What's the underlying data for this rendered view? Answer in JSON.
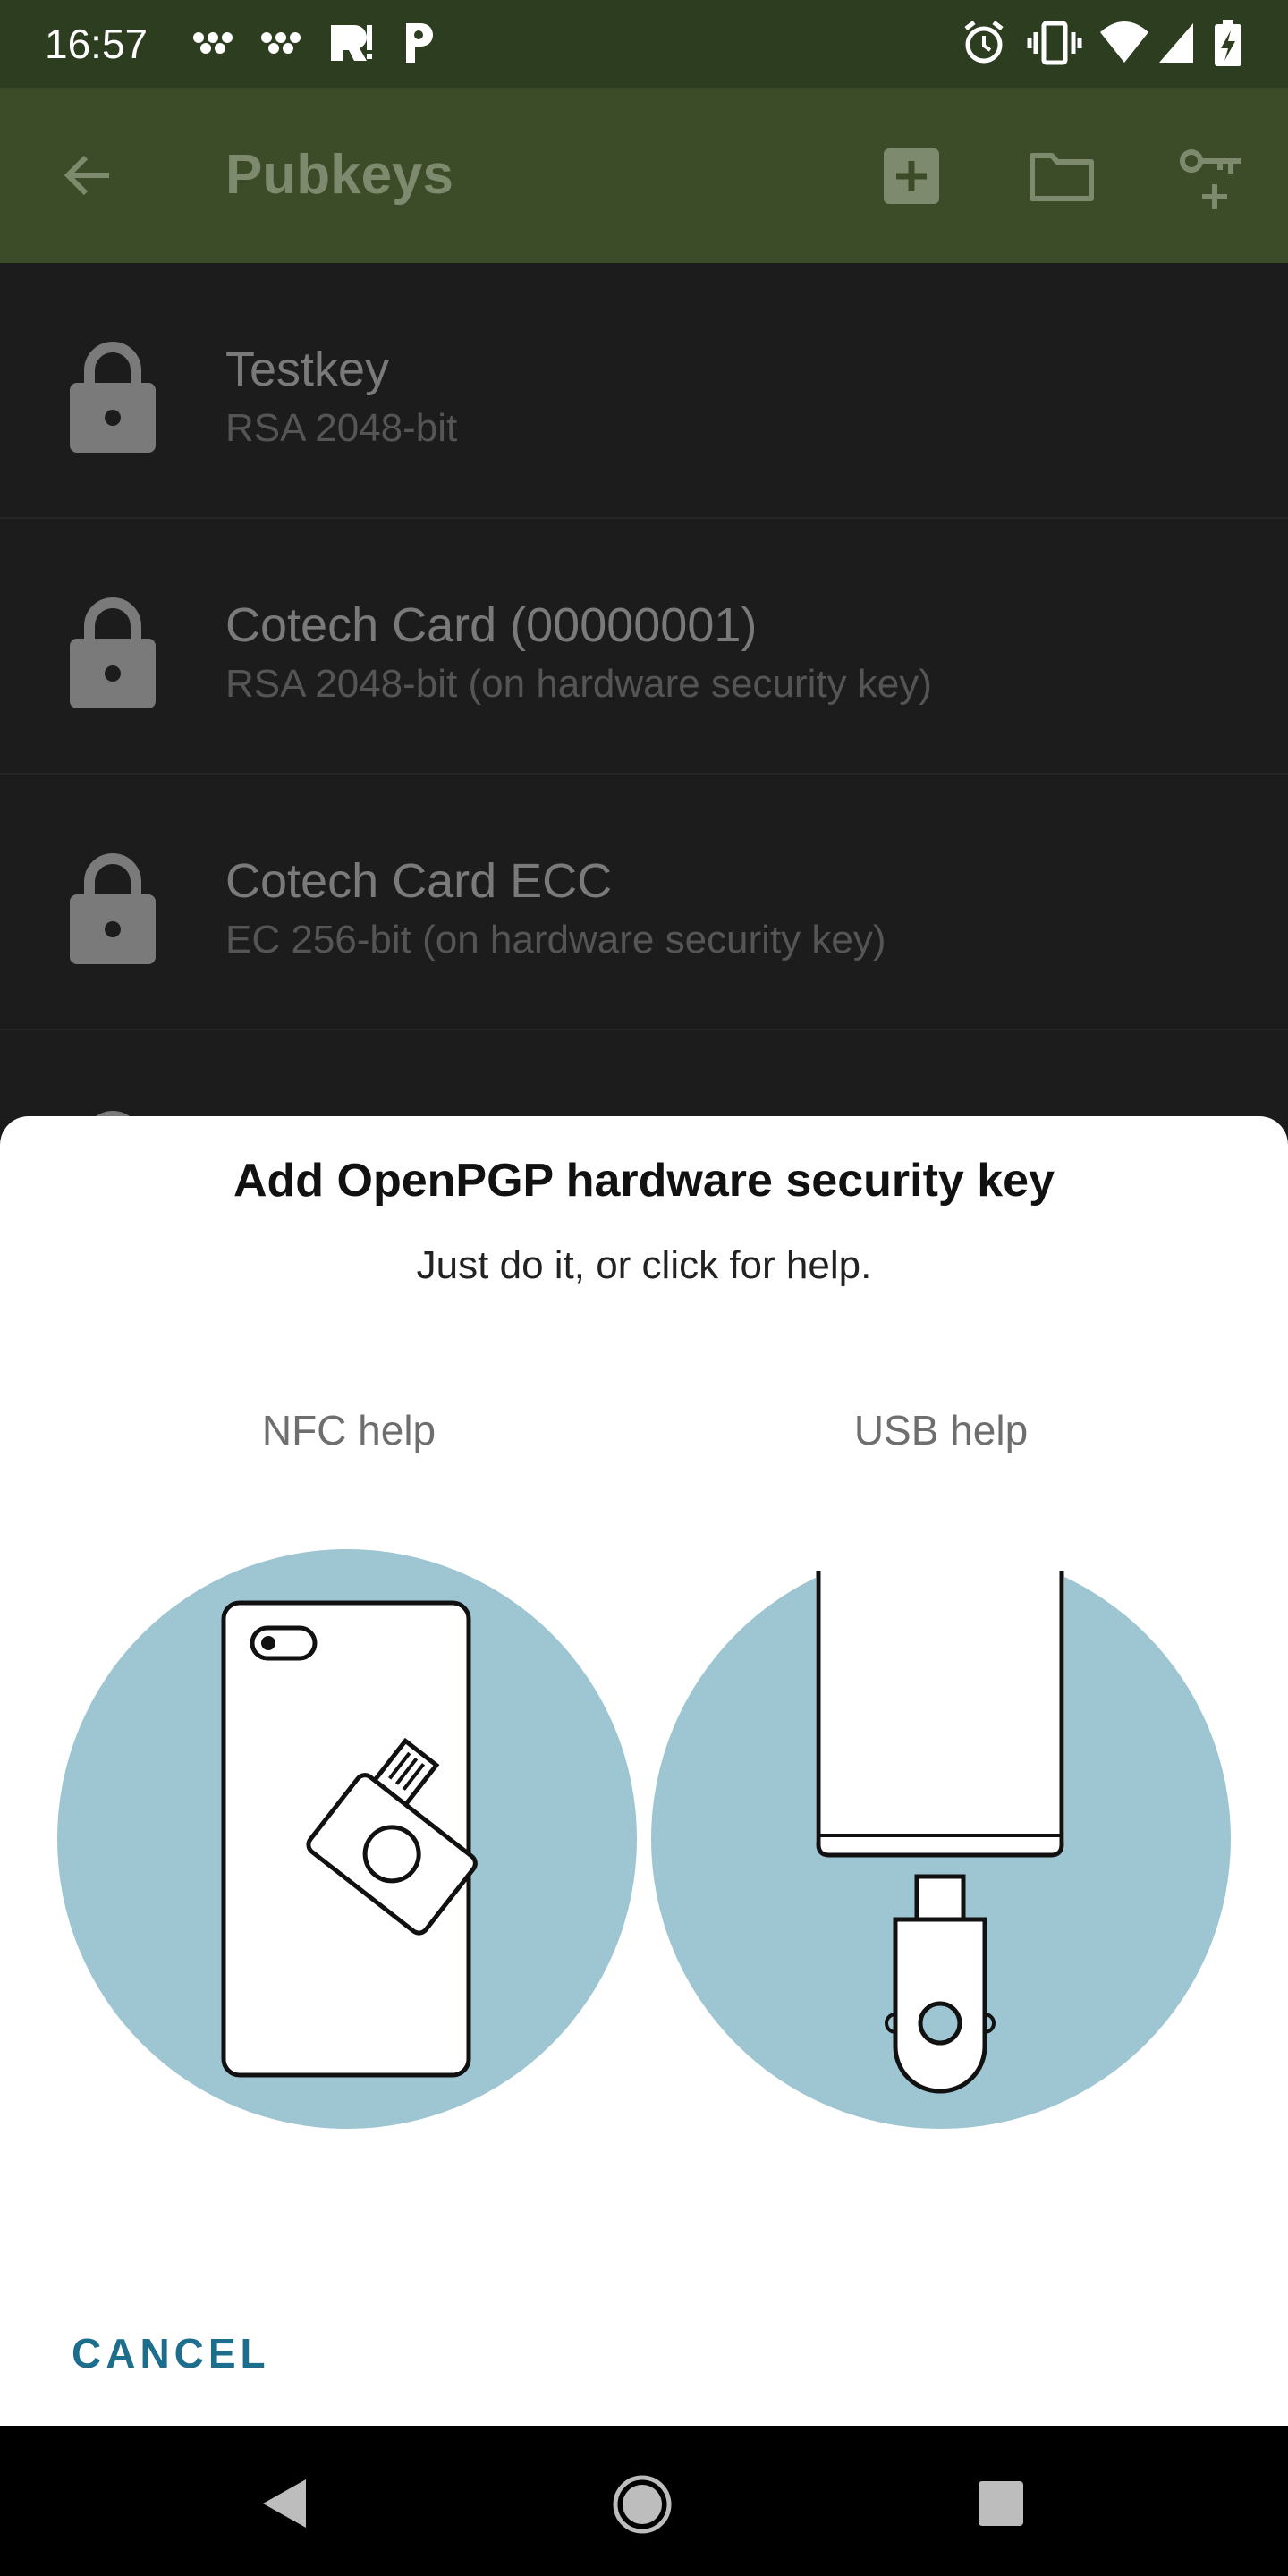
{
  "status_bar": {
    "time": "16:57",
    "left_icons": [
      "notification-dots-icon",
      "notification-dots-icon",
      "app-notification-icon",
      "p-app-icon"
    ],
    "right_icons": [
      "alarm-icon",
      "vibrate-icon",
      "wifi-icon",
      "signal-icon",
      "battery-charging-icon"
    ]
  },
  "app_bar": {
    "title": "Pubkeys",
    "actions": [
      "add-box-icon",
      "folder-icon",
      "key-add-icon"
    ]
  },
  "keys": [
    {
      "name": "Testkey",
      "detail": "RSA 2048-bit"
    },
    {
      "name": "Cotech Card (00000001)",
      "detail": "RSA 2048-bit (on hardware security key)"
    },
    {
      "name": "Cotech Card ECC",
      "detail": "EC 256-bit (on hardware security key)"
    }
  ],
  "dialog": {
    "title": "Add OpenPGP hardware security key",
    "subtitle": "Just do it, or click for help.",
    "nfc_label": "NFC help",
    "usb_label": "USB help",
    "cancel": "CANCEL"
  },
  "colors": {
    "status_bar": "#2d3d1f",
    "app_bar": "#3d4c28",
    "illustration_circle": "#9ec5d2",
    "accent": "#1c6e8c"
  }
}
